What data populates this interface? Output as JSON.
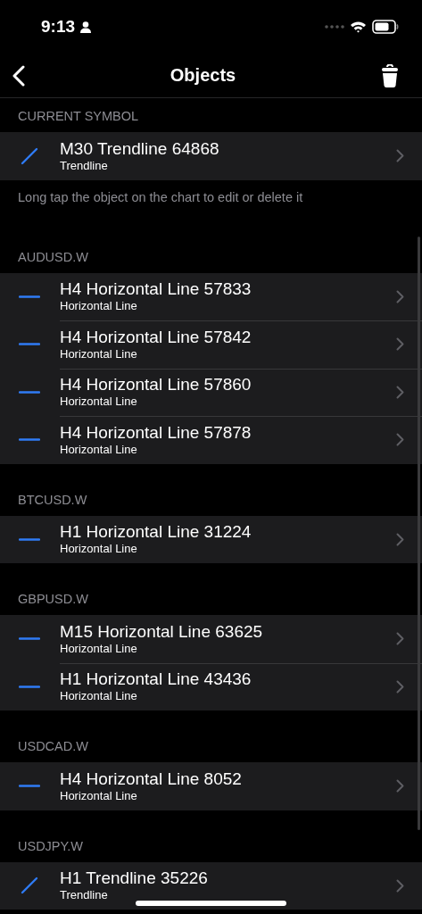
{
  "status_bar": {
    "time": "9:13"
  },
  "nav": {
    "title": "Objects"
  },
  "sections": [
    {
      "header": "CURRENT SYMBOL",
      "items": [
        {
          "kind": "trendline",
          "title": "M30 Trendline 64868",
          "subtitle": "Trendline"
        }
      ],
      "note": "Long tap the object on the chart to edit or delete it"
    },
    {
      "header": "AUDUSD.W",
      "items": [
        {
          "kind": "horizontal",
          "title": "H4 Horizontal Line 57833",
          "subtitle": "Horizontal Line"
        },
        {
          "kind": "horizontal",
          "title": "H4 Horizontal Line 57842",
          "subtitle": "Horizontal Line"
        },
        {
          "kind": "horizontal",
          "title": "H4 Horizontal Line 57860",
          "subtitle": "Horizontal Line"
        },
        {
          "kind": "horizontal",
          "title": "H4 Horizontal Line 57878",
          "subtitle": "Horizontal Line"
        }
      ]
    },
    {
      "header": "BTCUSD.W",
      "items": [
        {
          "kind": "horizontal",
          "title": "H1 Horizontal Line 31224",
          "subtitle": "Horizontal Line"
        }
      ]
    },
    {
      "header": "GBPUSD.W",
      "items": [
        {
          "kind": "horizontal",
          "title": "M15 Horizontal Line 63625",
          "subtitle": "Horizontal Line"
        },
        {
          "kind": "horizontal",
          "title": "H1 Horizontal Line 43436",
          "subtitle": "Horizontal Line"
        }
      ]
    },
    {
      "header": "USDCAD.W",
      "items": [
        {
          "kind": "horizontal",
          "title": "H4 Horizontal Line 8052",
          "subtitle": "Horizontal Line"
        }
      ]
    },
    {
      "header": "USDJPY.W",
      "items": [
        {
          "kind": "trendline",
          "title": "H1 Trendline 35226",
          "subtitle": "Trendline"
        }
      ]
    }
  ]
}
